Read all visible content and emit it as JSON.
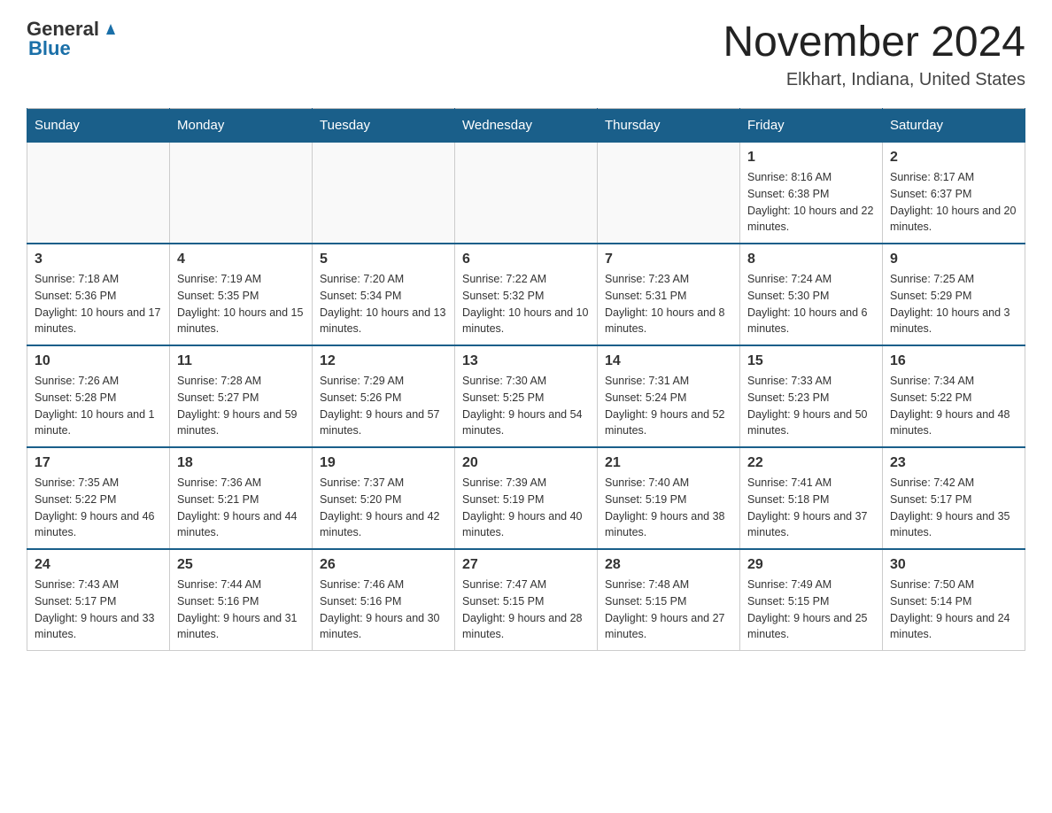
{
  "logo": {
    "general": "General",
    "blue": "Blue",
    "triangle": "▲"
  },
  "title": "November 2024",
  "location": "Elkhart, Indiana, United States",
  "weekdays": [
    "Sunday",
    "Monday",
    "Tuesday",
    "Wednesday",
    "Thursday",
    "Friday",
    "Saturday"
  ],
  "weeks": [
    [
      {
        "day": "",
        "sunrise": "",
        "sunset": "",
        "daylight": ""
      },
      {
        "day": "",
        "sunrise": "",
        "sunset": "",
        "daylight": ""
      },
      {
        "day": "",
        "sunrise": "",
        "sunset": "",
        "daylight": ""
      },
      {
        "day": "",
        "sunrise": "",
        "sunset": "",
        "daylight": ""
      },
      {
        "day": "",
        "sunrise": "",
        "sunset": "",
        "daylight": ""
      },
      {
        "day": "1",
        "sunrise": "Sunrise: 8:16 AM",
        "sunset": "Sunset: 6:38 PM",
        "daylight": "Daylight: 10 hours and 22 minutes."
      },
      {
        "day": "2",
        "sunrise": "Sunrise: 8:17 AM",
        "sunset": "Sunset: 6:37 PM",
        "daylight": "Daylight: 10 hours and 20 minutes."
      }
    ],
    [
      {
        "day": "3",
        "sunrise": "Sunrise: 7:18 AM",
        "sunset": "Sunset: 5:36 PM",
        "daylight": "Daylight: 10 hours and 17 minutes."
      },
      {
        "day": "4",
        "sunrise": "Sunrise: 7:19 AM",
        "sunset": "Sunset: 5:35 PM",
        "daylight": "Daylight: 10 hours and 15 minutes."
      },
      {
        "day": "5",
        "sunrise": "Sunrise: 7:20 AM",
        "sunset": "Sunset: 5:34 PM",
        "daylight": "Daylight: 10 hours and 13 minutes."
      },
      {
        "day": "6",
        "sunrise": "Sunrise: 7:22 AM",
        "sunset": "Sunset: 5:32 PM",
        "daylight": "Daylight: 10 hours and 10 minutes."
      },
      {
        "day": "7",
        "sunrise": "Sunrise: 7:23 AM",
        "sunset": "Sunset: 5:31 PM",
        "daylight": "Daylight: 10 hours and 8 minutes."
      },
      {
        "day": "8",
        "sunrise": "Sunrise: 7:24 AM",
        "sunset": "Sunset: 5:30 PM",
        "daylight": "Daylight: 10 hours and 6 minutes."
      },
      {
        "day": "9",
        "sunrise": "Sunrise: 7:25 AM",
        "sunset": "Sunset: 5:29 PM",
        "daylight": "Daylight: 10 hours and 3 minutes."
      }
    ],
    [
      {
        "day": "10",
        "sunrise": "Sunrise: 7:26 AM",
        "sunset": "Sunset: 5:28 PM",
        "daylight": "Daylight: 10 hours and 1 minute."
      },
      {
        "day": "11",
        "sunrise": "Sunrise: 7:28 AM",
        "sunset": "Sunset: 5:27 PM",
        "daylight": "Daylight: 9 hours and 59 minutes."
      },
      {
        "day": "12",
        "sunrise": "Sunrise: 7:29 AM",
        "sunset": "Sunset: 5:26 PM",
        "daylight": "Daylight: 9 hours and 57 minutes."
      },
      {
        "day": "13",
        "sunrise": "Sunrise: 7:30 AM",
        "sunset": "Sunset: 5:25 PM",
        "daylight": "Daylight: 9 hours and 54 minutes."
      },
      {
        "day": "14",
        "sunrise": "Sunrise: 7:31 AM",
        "sunset": "Sunset: 5:24 PM",
        "daylight": "Daylight: 9 hours and 52 minutes."
      },
      {
        "day": "15",
        "sunrise": "Sunrise: 7:33 AM",
        "sunset": "Sunset: 5:23 PM",
        "daylight": "Daylight: 9 hours and 50 minutes."
      },
      {
        "day": "16",
        "sunrise": "Sunrise: 7:34 AM",
        "sunset": "Sunset: 5:22 PM",
        "daylight": "Daylight: 9 hours and 48 minutes."
      }
    ],
    [
      {
        "day": "17",
        "sunrise": "Sunrise: 7:35 AM",
        "sunset": "Sunset: 5:22 PM",
        "daylight": "Daylight: 9 hours and 46 minutes."
      },
      {
        "day": "18",
        "sunrise": "Sunrise: 7:36 AM",
        "sunset": "Sunset: 5:21 PM",
        "daylight": "Daylight: 9 hours and 44 minutes."
      },
      {
        "day": "19",
        "sunrise": "Sunrise: 7:37 AM",
        "sunset": "Sunset: 5:20 PM",
        "daylight": "Daylight: 9 hours and 42 minutes."
      },
      {
        "day": "20",
        "sunrise": "Sunrise: 7:39 AM",
        "sunset": "Sunset: 5:19 PM",
        "daylight": "Daylight: 9 hours and 40 minutes."
      },
      {
        "day": "21",
        "sunrise": "Sunrise: 7:40 AM",
        "sunset": "Sunset: 5:19 PM",
        "daylight": "Daylight: 9 hours and 38 minutes."
      },
      {
        "day": "22",
        "sunrise": "Sunrise: 7:41 AM",
        "sunset": "Sunset: 5:18 PM",
        "daylight": "Daylight: 9 hours and 37 minutes."
      },
      {
        "day": "23",
        "sunrise": "Sunrise: 7:42 AM",
        "sunset": "Sunset: 5:17 PM",
        "daylight": "Daylight: 9 hours and 35 minutes."
      }
    ],
    [
      {
        "day": "24",
        "sunrise": "Sunrise: 7:43 AM",
        "sunset": "Sunset: 5:17 PM",
        "daylight": "Daylight: 9 hours and 33 minutes."
      },
      {
        "day": "25",
        "sunrise": "Sunrise: 7:44 AM",
        "sunset": "Sunset: 5:16 PM",
        "daylight": "Daylight: 9 hours and 31 minutes."
      },
      {
        "day": "26",
        "sunrise": "Sunrise: 7:46 AM",
        "sunset": "Sunset: 5:16 PM",
        "daylight": "Daylight: 9 hours and 30 minutes."
      },
      {
        "day": "27",
        "sunrise": "Sunrise: 7:47 AM",
        "sunset": "Sunset: 5:15 PM",
        "daylight": "Daylight: 9 hours and 28 minutes."
      },
      {
        "day": "28",
        "sunrise": "Sunrise: 7:48 AM",
        "sunset": "Sunset: 5:15 PM",
        "daylight": "Daylight: 9 hours and 27 minutes."
      },
      {
        "day": "29",
        "sunrise": "Sunrise: 7:49 AM",
        "sunset": "Sunset: 5:15 PM",
        "daylight": "Daylight: 9 hours and 25 minutes."
      },
      {
        "day": "30",
        "sunrise": "Sunrise: 7:50 AM",
        "sunset": "Sunset: 5:14 PM",
        "daylight": "Daylight: 9 hours and 24 minutes."
      }
    ]
  ]
}
